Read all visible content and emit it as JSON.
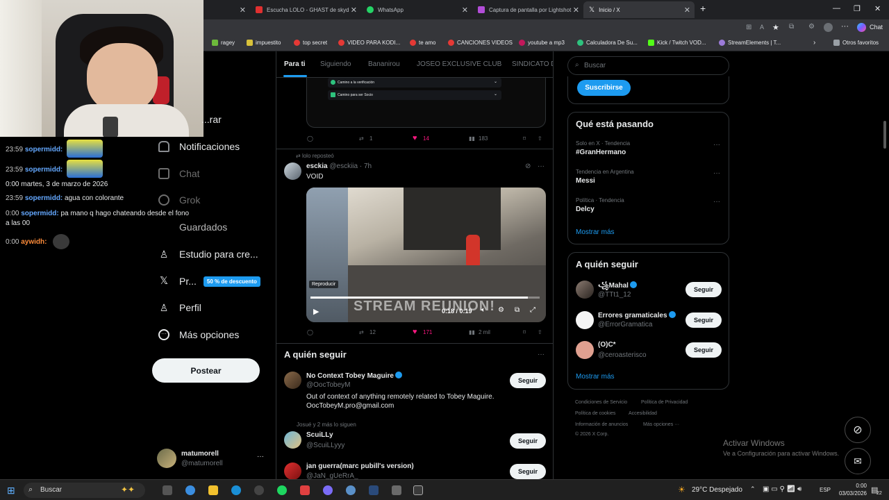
{
  "browser": {
    "tabs": [
      {
        "label": "",
        "active": false
      },
      {
        "label": "Escucha LOLO - GHAST de skyde",
        "active": false
      },
      {
        "label": "WhatsApp",
        "active": false
      },
      {
        "label": "Captura de pantalla por Lightshot",
        "active": false
      },
      {
        "label": "Inicio / X",
        "active": true
      }
    ],
    "new_tab_label": "+",
    "chat_label": "Chat",
    "bookmarks": [
      "ragey",
      "impuestito",
      "top secret",
      "VIDEO PARA KODI...",
      "te amo",
      "CANCIONES VIDEOS",
      "youtube a mp3",
      "Calculadora De Su...",
      "Kick / Twitch VOD...",
      "StreamElements | T..."
    ],
    "other_favorites": "Otros favoritos"
  },
  "overlay_chat": {
    "lines": [
      {
        "time": "23:59",
        "user": "sopermidd:",
        "msg": ""
      },
      {
        "time": "23:59",
        "user": "sopermidd:",
        "msg": ""
      },
      {
        "system": "0:00 martes, 3 de marzo de 2026"
      },
      {
        "time": "23:59",
        "user": "sopermidd:",
        "msg": "agua con colorante"
      },
      {
        "time": "0:00",
        "user": "sopermidd:",
        "msg": "pa mano q hago chateando desde el fono a las 00"
      },
      {
        "time": "0:00",
        "user": "aywidh:",
        "msg": ""
      }
    ]
  },
  "nav": {
    "items": [
      "...rar",
      "Notificaciones",
      "Chat",
      "Grok",
      "Guardados",
      "Estudio para cre...",
      "Pr...",
      "Perfil",
      "Más opciones"
    ],
    "premium_badge": "50 % de descuento",
    "post_button": "Postear",
    "account_name": "matumorell",
    "account_handle": "@matumorell",
    "account_more": "···"
  },
  "feed_tabs": [
    "Para ti",
    "Siguiendo",
    "Bananirou",
    "JOSEO EXCLUSIVE CLUB",
    "SINDICATO D"
  ],
  "embedded_options": [
    "Camino a la verificación",
    "Camino para ser Socio"
  ],
  "post1_stats": {
    "replies": "",
    "reposts": "1",
    "likes": "14",
    "views": "183"
  },
  "post2": {
    "repost_label": "lolo reposteó",
    "name": "esckia",
    "handle": "@esckiia · 7h",
    "text": "VOID",
    "video_label": "Reproducir",
    "video_time": "0:18 / 0:19",
    "video_overlay": "STREAM REUNION!",
    "stats": {
      "replies": "",
      "reposts": "12",
      "likes": "171",
      "views": "2 mil"
    }
  },
  "who_to_follow_main": {
    "title": "A quién seguir",
    "more": "···",
    "accounts": [
      {
        "name": "No Context Tobey Maguire",
        "handle": "@OocTobeyM",
        "bio": "Out of context of anything remotely related to Tobey Maguire. OocTobeyM.pro@gmail.com",
        "context": "",
        "button": "Seguir",
        "verified": true
      },
      {
        "name": "ScuiLLy",
        "handle": "@ScuiLLyyy",
        "bio": "",
        "context": "Josué y 2 más lo siguen",
        "button": "Seguir",
        "verified": false
      },
      {
        "name": "jan guerra(marc pubill's version)",
        "handle": "@JaN_gUeRrA_",
        "bio": "",
        "context": "",
        "button": "Seguir",
        "verified": false
      }
    ]
  },
  "right": {
    "search_placeholder": "Buscar",
    "subscribe_button": "Suscribirse",
    "trends_title": "Qué está pasando",
    "trends": [
      {
        "context": "Solo en X · Tendencia",
        "name": "#GranHermano"
      },
      {
        "context": "Tendencia en Argentina",
        "name": "Messi"
      },
      {
        "context": "Política · Tendencia",
        "name": "Delcy"
      }
    ],
    "show_more": "Mostrar más",
    "follow_title": "A quién seguir",
    "follow": [
      {
        "name": "꧁Mahal",
        "handle": "@TTt1_12",
        "button": "Seguir",
        "verified": true
      },
      {
        "name": "Errores gramaticales",
        "handle": "@ErrorGramatica",
        "button": "Seguir",
        "verified": true
      },
      {
        "name": "(O)C*",
        "handle": "@ceroasterisco",
        "button": "Seguir",
        "verified": false
      }
    ],
    "follow_more": "Mostrar más",
    "footer": [
      "Condiciones de Servicio",
      "Política de Privacidad",
      "Política de cookies",
      "Accesibilidad",
      "Información de anuncios",
      "Más opciones ···",
      "© 2026 X Corp."
    ]
  },
  "activate_windows": {
    "title": "Activar Windows",
    "subtitle": "Ve a Configuración para activar Windows."
  },
  "taskbar": {
    "search": "Buscar",
    "weather": "29°C Despejado",
    "lang": "ESP",
    "time": "0:00",
    "date": "03/03/2026",
    "badge": "22"
  },
  "colors": {
    "accent": "#1d9bf0",
    "like": "#f91880",
    "bg": "#000000",
    "border": "#2f3336"
  }
}
